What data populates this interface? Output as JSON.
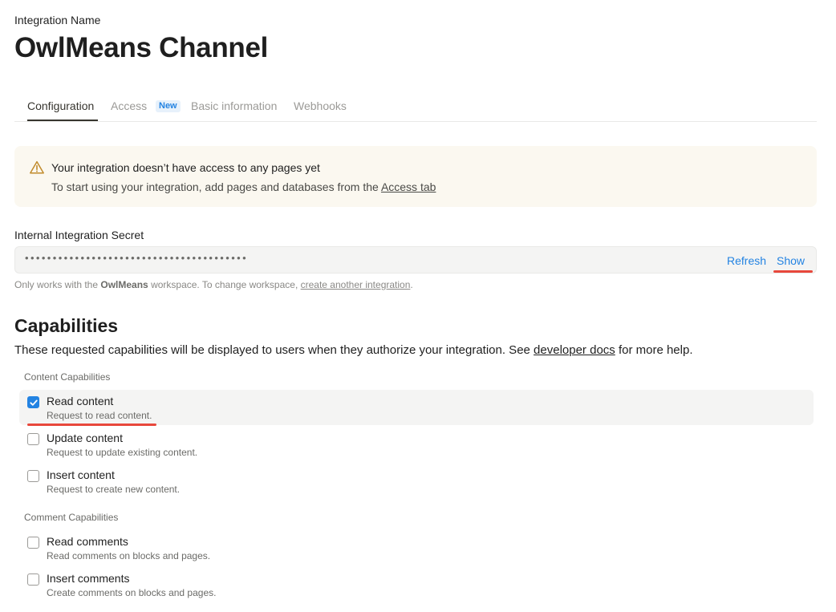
{
  "header": {
    "label": "Integration Name",
    "title": "OwlMeans Channel"
  },
  "tabs": [
    {
      "label": "Configuration",
      "active": true
    },
    {
      "label": "Access",
      "badge": "New"
    },
    {
      "label": "Basic information"
    },
    {
      "label": "Webhooks"
    }
  ],
  "alert": {
    "icon": "warning-triangle-icon",
    "title": "Your integration doesn’t have access to any pages yet",
    "desc_prefix": "To start using your integration, add pages and databases from the ",
    "desc_link": "Access tab"
  },
  "secret": {
    "label": "Internal Integration Secret",
    "masked_value": "••••••••••••••••••••••••••••••••••••••••",
    "refresh_label": "Refresh",
    "show_label": "Show",
    "note_prefix": "Only works with the ",
    "note_workspace": "OwlMeans",
    "note_middle": " workspace. To change workspace, ",
    "note_link": "create another integration",
    "note_suffix": "."
  },
  "capabilities": {
    "title": "Capabilities",
    "desc_prefix": "These requested capabilities will be displayed to users when they authorize your integration. See ",
    "desc_link": "developer docs",
    "desc_suffix": " for more help.",
    "content_group": {
      "label": "Content Capabilities",
      "items": [
        {
          "name": "Read content",
          "desc": "Request to read content.",
          "checked": true
        },
        {
          "name": "Update content",
          "desc": "Request to update existing content.",
          "checked": false
        },
        {
          "name": "Insert content",
          "desc": "Request to create new content.",
          "checked": false
        }
      ]
    },
    "comment_group": {
      "label": "Comment Capabilities",
      "items": [
        {
          "name": "Read comments",
          "desc": "Read comments on blocks and pages.",
          "checked": false
        },
        {
          "name": "Insert comments",
          "desc": "Create comments on blocks and pages.",
          "checked": false
        }
      ]
    }
  },
  "colors": {
    "accent": "#2383e2",
    "highlight_marker": "#e8483c",
    "alert_bg": "#fbf8f0",
    "warning_icon": "#c18b2c"
  }
}
